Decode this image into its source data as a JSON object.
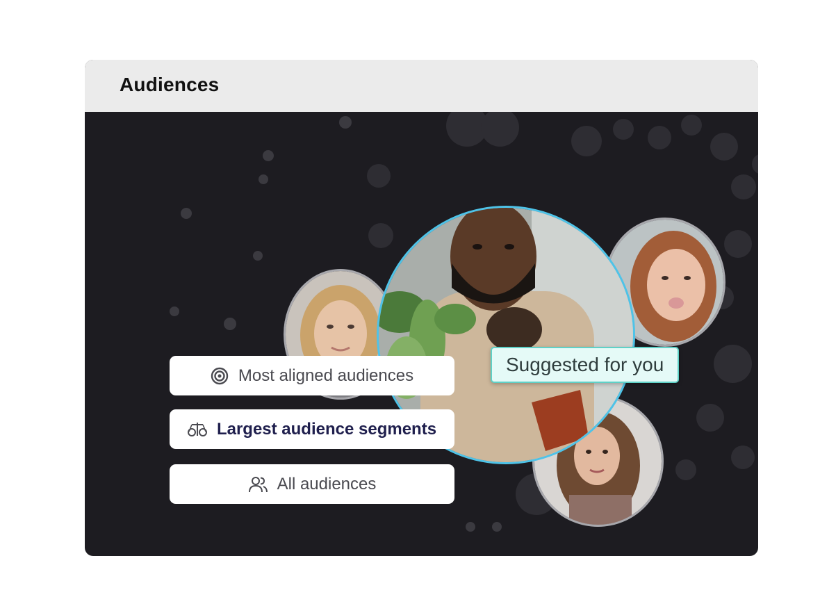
{
  "header": {
    "title": "Audiences"
  },
  "suggestion_badge": {
    "label": "Suggested for you"
  },
  "filters": [
    {
      "label": "Most aligned audiences",
      "icon": "target-icon",
      "active": false
    },
    {
      "label": "Largest audience segments",
      "icon": "scale-icon",
      "active": true
    },
    {
      "label": "All audiences",
      "icon": "people-icon",
      "active": false
    }
  ],
  "avatars": [
    {
      "description": "blonde-woman-portrait"
    },
    {
      "description": "man-holding-plant"
    },
    {
      "description": "girl-sticking-tongue-out"
    },
    {
      "description": "brunette-woman-portrait"
    }
  ],
  "colors": {
    "panel_bg": "#1d1c21",
    "header_bg": "#ebebeb",
    "badge_bg": "#e5faf7",
    "badge_border": "#5fd1c7",
    "highlight_ring": "#4ec3e8"
  }
}
